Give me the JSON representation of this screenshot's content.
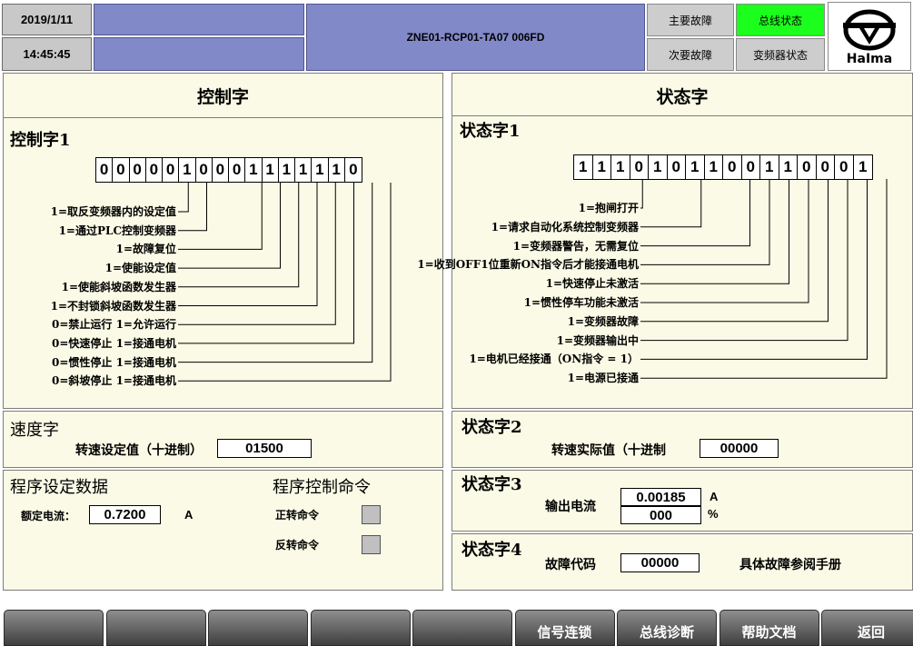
{
  "header": {
    "date": "2019/1/11",
    "time": "14:45:45",
    "station": "ZNE01-RCP01-TA07 006FD",
    "buttons": {
      "major_fault": "主要故障",
      "bus_status": "总线状态",
      "minor_fault": "次要故障",
      "inverter_status": "变频器状态"
    },
    "logo_text": "HaIma",
    "accent_active": "#1cff1c",
    "header_blue": "#8289c9"
  },
  "left": {
    "title": "控制字",
    "cw1": {
      "label": "控制字1",
      "bits": [
        "0",
        "0",
        "0",
        "0",
        "0",
        "1",
        "0",
        "0",
        "0",
        "1",
        "1",
        "1",
        "1",
        "1",
        "1",
        "0"
      ],
      "items": [
        "1=取反变频器内的设定值",
        "1=通过PLC控制变频器",
        "1=故障复位",
        "1=使能设定值",
        "1=使能斜坡函数发生器",
        "1=不封锁斜坡函数发生器",
        "0=禁止运行  1=允许运行",
        "0=快速停止  1=接通电机",
        "0=惯性停止  1=接通电机",
        "0=斜坡停止  1=接通电机"
      ]
    },
    "speed": {
      "label": "速度字",
      "field_label": "转速设定值（十进制）",
      "value": "01500"
    },
    "program": {
      "label": "程序设定数据",
      "rated_current_label": "额定电流：",
      "rated_current": "0.7200",
      "rated_current_unit": "A"
    },
    "commands": {
      "label": "程序控制命令",
      "forward": "正转命令",
      "reverse": "反转命令"
    }
  },
  "right": {
    "title": "状态字",
    "sw1": {
      "label": "状态字1",
      "bits": [
        "1",
        "1",
        "1",
        "0",
        "1",
        "0",
        "1",
        "1",
        "0",
        "0",
        "1",
        "1",
        "0",
        "0",
        "0",
        "1"
      ],
      "items": [
        "1=抱闸打开",
        "1=请求自动化系统控制变频器",
        "1=变频器警告，无需复位",
        "1=收到OFF1位重新ON指令后才能接通电机",
        "1=快速停止未激活",
        "1=惯性停车功能未激活",
        "1=变频器故障",
        "1=变频器输出中",
        "1=电机已经接通（ON指令 = 1）",
        "1=电源已接通"
      ]
    },
    "sw2": {
      "label": "状态字2",
      "field_label": "转速实际值（十进制",
      "value": "00000"
    },
    "sw3": {
      "label": "状态字3",
      "field_label": "输出电流",
      "current": "0.00185",
      "current_unit": "A",
      "percent": "000",
      "percent_unit": "%"
    },
    "sw4": {
      "label": "状态字4",
      "field_label": "故障代码",
      "value": "00000",
      "note": "具体故障参阅手册"
    }
  },
  "footer": {
    "buttons": [
      "",
      "",
      "",
      "",
      "",
      "信号连锁",
      "总线诊断",
      "帮助文档",
      "返回"
    ]
  }
}
